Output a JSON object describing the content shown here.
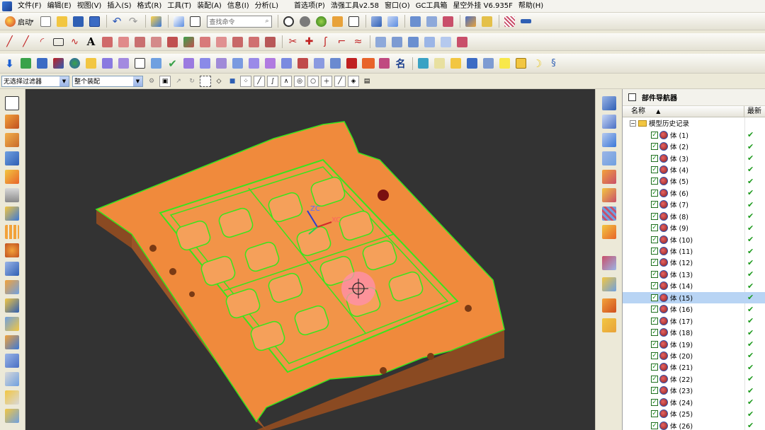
{
  "menu": {
    "items": [
      "文件(F)",
      "编辑(E)",
      "视图(V)",
      "插入(S)",
      "格式(R)",
      "工具(T)",
      "装配(A)",
      "信息(I)",
      "分析(L)"
    ],
    "extra_items": [
      "首选项(P)",
      "浩强工具v2.58",
      "窗口(O)",
      "GC工具箱",
      "星空外挂 V6.935F",
      "帮助(H)"
    ]
  },
  "toolbar1": {
    "start_label": "启动",
    "search_placeholder": "查找命令"
  },
  "selection_bar": {
    "filter_value": "无选择过滤器",
    "scope_value": "整个装配"
  },
  "navigator": {
    "title": "部件导航器",
    "col_name": "名称",
    "col_latest": "最新",
    "root_label": "模型历史记录",
    "selected_index": 14,
    "items": [
      "体 (1)",
      "体 (2)",
      "体 (3)",
      "体 (4)",
      "体 (5)",
      "体 (6)",
      "体 (7)",
      "体 (8)",
      "体 (9)",
      "体 (10)",
      "体 (11)",
      "体 (12)",
      "体 (13)",
      "体 (14)",
      "体 (15)",
      "体 (16)",
      "体 (17)",
      "体 (18)",
      "体 (19)",
      "体 (20)",
      "体 (21)",
      "体 (22)",
      "体 (23)",
      "体 (24)",
      "体 (25)",
      "体 (26)"
    ],
    "latest_mark": "✔"
  },
  "viewport": {
    "axis_zc": "ZC",
    "axis_xc": "XC",
    "background": "#333333",
    "part_color": "#f08a3c",
    "edge_color": "#39e51c"
  }
}
